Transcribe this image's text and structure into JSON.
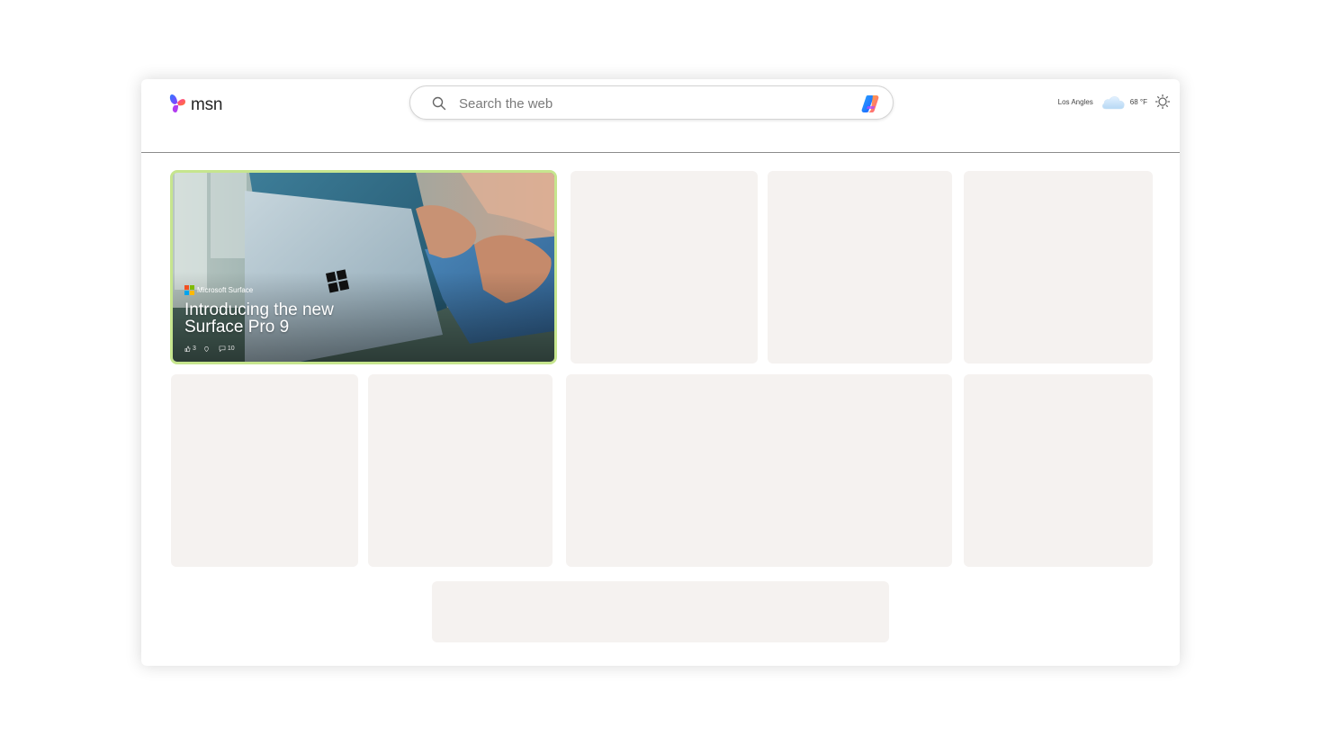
{
  "header": {
    "logo_text": "msn",
    "search": {
      "placeholder": "Search the web"
    },
    "weather": {
      "city": "Los Angles",
      "temp": "68 °F"
    }
  },
  "hero_card": {
    "publisher": "Microsoft Surface",
    "headline": "Introducing the new Surface Pro 9",
    "likes": "3",
    "comments": "10"
  },
  "colors": {
    "placeholder_card": "#f5f2f0",
    "hero_border": "#c6e58e"
  },
  "icons": [
    "msn-butterfly-logo",
    "search-icon",
    "copilot-icon",
    "cloud-icon",
    "settings-icon",
    "microsoft-logo",
    "like-icon",
    "dislike-icon",
    "comment-icon"
  ]
}
